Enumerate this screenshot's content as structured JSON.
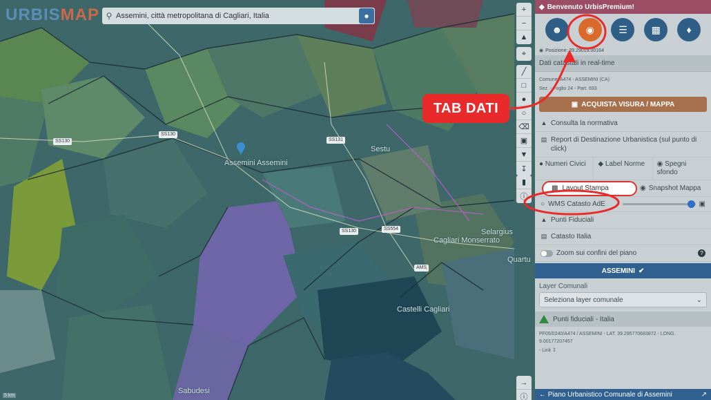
{
  "logo": {
    "urbis": "URBIS",
    "map": "MAP"
  },
  "search": {
    "value": "Assemini, città metropolitana di Cagliari, Italia"
  },
  "map": {
    "labels": [
      "Assemini Assemini",
      "Sestu",
      "Cagliari Monserrato",
      "Castelli Cagliari",
      "Sabudesi",
      "Selargius",
      "Quartu"
    ],
    "roads": [
      "SS130",
      "SS130",
      "SS131",
      "SS130",
      "SS554",
      "AMS"
    ],
    "scale": "5 km"
  },
  "annotation": {
    "label": "TAB DATI"
  },
  "sidebar": {
    "welcome": "Benvenuto UrbisPremium!",
    "position": "Posizione: 39.29019.00164",
    "cadastral_header": "Dati catastali in real-time",
    "comune_line": "Comune: A474 - ASSEMINI (CA)",
    "sez_line": "Sez. - Foglio 24 - Part. 693",
    "buy_button": "ACQUISTA VISURA / MAPPA",
    "normativa": "Consulta la normativa",
    "report": "Report di Destinazione Urbanistica (sul punto di click)",
    "grid": {
      "numeri": "Numeri Civici",
      "label": "Label Norme",
      "spegni": "Spegni sfondo"
    },
    "layout_stampa": "Layout Stampa",
    "snapshot": "Snapshot Mappa",
    "wms": "WMS Catasto AdE",
    "wms_opacity": 0.95,
    "punti_fiduciali": "Punti Fiduciali",
    "catasto_italia": "Catasto Italia",
    "zoom_confini": "Zoom sui confini del piano",
    "comune_bar": "ASSEMINI",
    "layer_comunali": "Layer Comunali",
    "select_placeholder": "Seleziona layer comunale",
    "pf_header": "Punti fiduciali - Italia",
    "pf_text": "PF05/0240/A474 / ASSEMINI - LAT. 39.295770683872 - LONG. 9.00177207457",
    "pf_link": "- Link",
    "bottom_bar": "Piano Urbanistico Comunale di Assemini"
  }
}
